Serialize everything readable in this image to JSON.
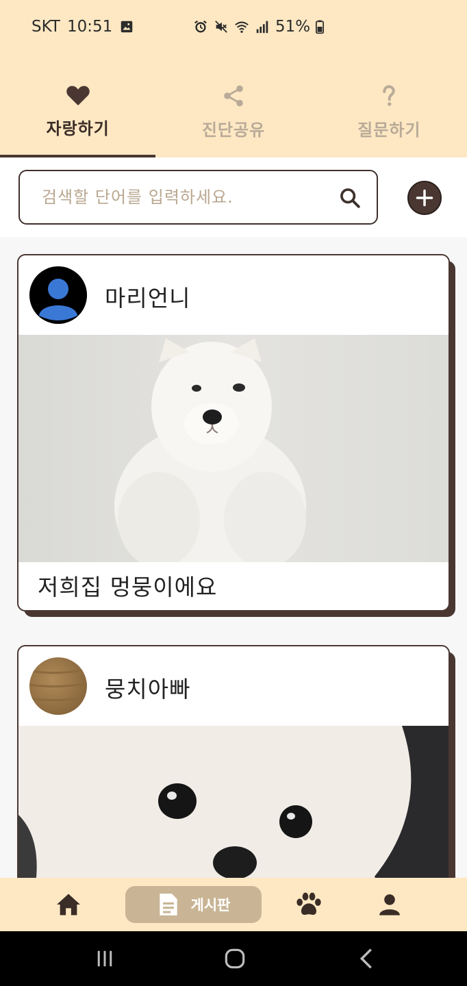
{
  "status_bar": {
    "carrier": "SKT",
    "time": "10:51",
    "battery": "51%"
  },
  "tabs": [
    {
      "label": "자랑하기",
      "icon": "heart-icon",
      "active": true
    },
    {
      "label": "진단공유",
      "icon": "share-icon",
      "active": false
    },
    {
      "label": "질문하기",
      "icon": "question-icon",
      "active": false
    }
  ],
  "search": {
    "placeholder": "검색할 단어를 입력하세요.",
    "value": ""
  },
  "posts": [
    {
      "author": "마리언니",
      "avatar": "default-user-avatar",
      "photo": "white-samoyed-puppy",
      "caption": "저희집 멍뭉이에요"
    },
    {
      "author": "뭉치아빠",
      "avatar": "wood-texture-avatar",
      "photo": "white-pomeranian-closeup",
      "caption": ""
    }
  ],
  "bottom_nav": {
    "items": [
      {
        "icon": "home-icon"
      },
      {
        "icon": "document-icon",
        "label": "게시판",
        "active": true
      },
      {
        "icon": "paw-icon"
      },
      {
        "icon": "person-icon"
      }
    ]
  },
  "colors": {
    "header_bg": "#fde8c3",
    "accent_dark": "#4a3732",
    "active_pill": "#c9b595",
    "inactive_tab": "#b9aa98"
  }
}
